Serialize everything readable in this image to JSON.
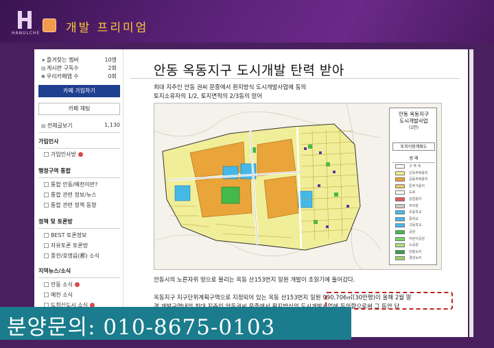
{
  "header": {
    "logo_text": "HANULCHE",
    "title": "개발 프리미엄",
    "accent": "#f39a4b",
    "title_color": "#ffc83a"
  },
  "sidebar": {
    "stats": [
      {
        "icon": "star-icon",
        "label": "즐겨찾는 멤버",
        "value": "10명"
      },
      {
        "icon": "list-icon",
        "label": "게시판 구독수",
        "value": "2회"
      },
      {
        "icon": "gear-icon",
        "label": "우리카페앱 수",
        "value": "0회"
      }
    ],
    "join_label": "카페 가입하기",
    "chat_label": "카페 채팅",
    "total_label": "전체글보기",
    "total_value": "1,130",
    "sections": [
      {
        "title": "가입인사",
        "items": [
          {
            "label": "가입인사방",
            "new": true
          }
        ]
      },
      {
        "title": "행정구역 통합",
        "items": [
          {
            "label": "통합 안동/예천이란?",
            "new": false
          },
          {
            "label": "통합 관련 정보/뉴스",
            "new": false
          },
          {
            "label": "통합 관련 정책 동향",
            "new": false
          }
        ]
      },
      {
        "title": "정책 및 토론방",
        "items": [
          {
            "label": "BEST 토론정보",
            "new": false
          },
          {
            "label": "자유토론 토론방",
            "new": false
          },
          {
            "label": "풍전/호명읍(郡) 소식",
            "new": false
          }
        ]
      },
      {
        "title": "지역뉴스/소식",
        "items": [
          {
            "label": "안동 소식",
            "new": true
          },
          {
            "label": "예천 소식",
            "new": false
          },
          {
            "label": "도청신도시 소식",
            "new": true
          }
        ]
      }
    ]
  },
  "article": {
    "title": "안동 옥동지구 도시개발 탄력 받아",
    "para1_line1": "최대 지주인 안동 권씨 문중에서 환지방식 도시개발사업에 동의",
    "para1_line2": "토지소유자의 1/2, 토지면적의 2/3동의 얻어",
    "caption": "안동시의 노른자위 땅으로 불리는 옥동 산153번지 일원 개발이 초읽기에 들어갔다.",
    "para2_line1": "옥동지구 지구단위계획구역으로 지정되어 있는 옥동 산153번지 일원 990,706㎡(30만평)이 올해 2월 말",
    "para2_line2": "경 개발구역내의 최대 지주인 안동권씨 문중에서 환지방식의 도시개발사업에 동의함으로써 그 동안 답"
  },
  "map": {
    "title_line1": "안동 옥동지구",
    "title_line2": "도시개발사업",
    "title_line3": "(1안)",
    "plan_label": "토지이용계획도",
    "legend_head": "범 례",
    "legend": [
      {
        "label": "구 역 계",
        "color": "#ffffff"
      },
      {
        "label": "단독주택용지",
        "color": "#f5ef8a"
      },
      {
        "label": "공동주택용지",
        "color": "#e9a43a"
      },
      {
        "label": "준주거용지",
        "color": "#f0c46a"
      },
      {
        "label": "도로",
        "color": "#ffffff"
      },
      {
        "label": "상업용지",
        "color": "#e85a5a"
      },
      {
        "label": "주차장",
        "color": "#cfcfcf"
      },
      {
        "label": "초등학교",
        "color": "#46b8e8"
      },
      {
        "label": "중학교",
        "color": "#46b8e8"
      },
      {
        "label": "고등학교",
        "color": "#46b8e8"
      },
      {
        "label": "공원",
        "color": "#44b84a"
      },
      {
        "label": "어린이공원",
        "color": "#7ad06a"
      },
      {
        "label": "소공원",
        "color": "#a6e08a"
      },
      {
        "label": "완충녹지",
        "color": "#3a9e44"
      },
      {
        "label": "경관녹지",
        "color": "#9ccf6e"
      }
    ]
  },
  "banner": {
    "text": "분양문의: 010-8675-0103",
    "color": "#1a7c8c"
  }
}
